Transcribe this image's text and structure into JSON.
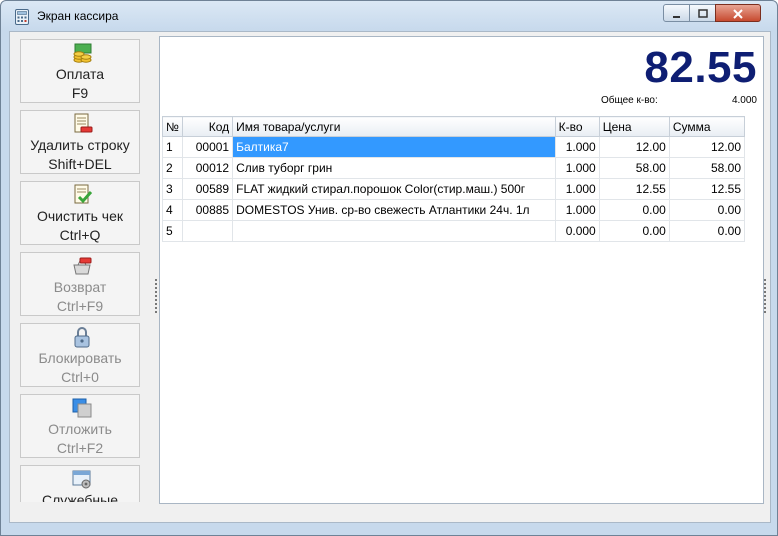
{
  "window": {
    "title": "Экран кассира"
  },
  "sidebar": {
    "buttons": [
      {
        "name": "pay",
        "line1": "Оплата",
        "line2": "F9",
        "enabled": true,
        "icon": "coins-icon"
      },
      {
        "name": "delete-row",
        "line1": "Удалить строку",
        "line2": "Shift+DEL",
        "enabled": true,
        "icon": "delete-document-icon"
      },
      {
        "name": "clear-check",
        "line1": "Очистить чек",
        "line2": "Ctrl+Q",
        "enabled": true,
        "icon": "check-document-icon"
      },
      {
        "name": "return",
        "line1": "Возврат",
        "line2": "Ctrl+F9",
        "enabled": false,
        "icon": "return-basket-icon"
      },
      {
        "name": "block",
        "line1": "Блокировать",
        "line2": "Ctrl+0",
        "enabled": false,
        "icon": "lock-icon"
      },
      {
        "name": "postpone",
        "line1": "Отложить",
        "line2": "Ctrl+F2",
        "enabled": false,
        "icon": "postpone-icon"
      },
      {
        "name": "service",
        "line1": "Служебные",
        "line2": "",
        "enabled": true,
        "icon": "service-icon"
      }
    ]
  },
  "summary": {
    "total": "82.55",
    "qty_label": "Общее к-во:",
    "qty_value": "4.000"
  },
  "table": {
    "headers": [
      "№",
      "Код",
      "Имя товара/услуги",
      "К-во",
      "Цена",
      "Сумма"
    ],
    "rows": [
      [
        "1",
        "00001",
        "Балтика7",
        "1.000",
        "12.00",
        "12.00"
      ],
      [
        "2",
        "00012",
        "Слив туборг грин",
        "1.000",
        "58.00",
        "58.00"
      ],
      [
        "3",
        "00589",
        "FLAT жидкий стирал.порошок Color(стир.маш.) 500г",
        "1.000",
        "12.55",
        "12.55"
      ],
      [
        "4",
        "00885",
        "DOMESTOS Унив. ср-во свежесть Атлантики 24ч. 1л",
        "1.000",
        "0.00",
        "0.00"
      ],
      [
        "5",
        "",
        "",
        "0.000",
        "0.00",
        "0.00"
      ]
    ]
  },
  "colors": {
    "total": "#0e1e73",
    "selection": "#3399ff"
  }
}
